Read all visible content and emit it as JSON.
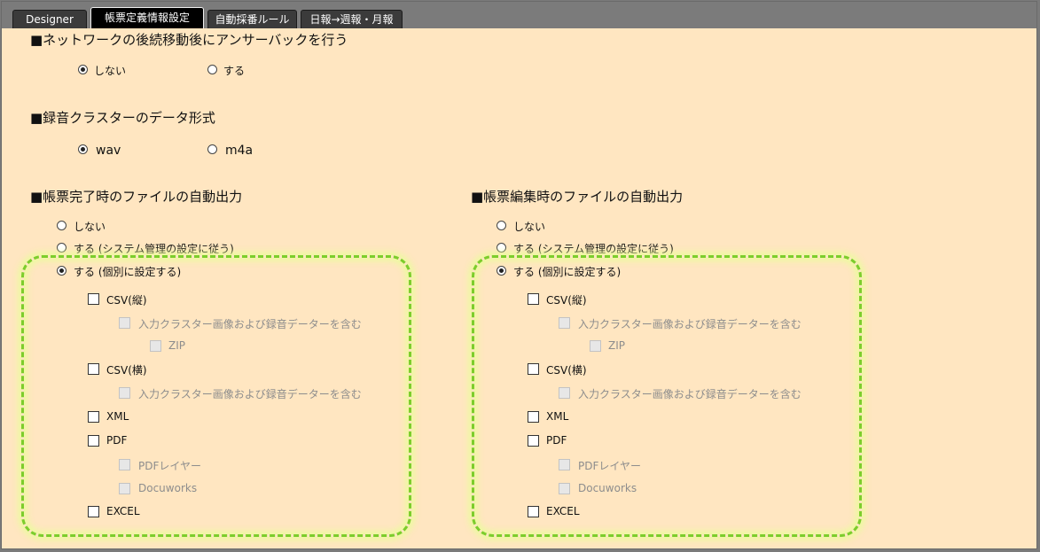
{
  "tabs": [
    {
      "label": "Designer"
    },
    {
      "label": "帳票定義情報設定"
    },
    {
      "label": "自動採番ルール"
    },
    {
      "label": "日報→週報・月報"
    }
  ],
  "answerback": {
    "heading": "■ネットワークの後続移動後にアンサーバックを行う",
    "options": [
      "しない",
      "する"
    ]
  },
  "audio_format": {
    "heading": "■録音クラスターのデータ形式",
    "options": [
      "wav",
      "m4a"
    ]
  },
  "auto_output_complete": {
    "heading": "■帳票完了時のファイルの自動出力",
    "options": [
      "しない",
      "する (システム管理の設定に従う)",
      "する (個別に設定する)"
    ],
    "csv_v": "CSV(縦)",
    "include_image_audio": "入力クラスター画像および録音データーを含む",
    "zip": "ZIP",
    "csv_h": "CSV(横)",
    "include_image_audio_h": "入力クラスター画像および録音データーを含む",
    "xml": "XML",
    "pdf": "PDF",
    "pdf_layer": "PDFレイヤー",
    "docuworks": "Docuworks",
    "excel": "EXCEL"
  },
  "auto_output_edit": {
    "heading": "■帳票編集時のファイルの自動出力",
    "options": [
      "しない",
      "する (システム管理の設定に従う)",
      "する (個別に設定する)"
    ],
    "csv_v": "CSV(縦)",
    "include_image_audio": "入力クラスター画像および録音データーを含む",
    "zip": "ZIP",
    "csv_h": "CSV(横)",
    "include_image_audio_h": "入力クラスター画像および録音データーを含む",
    "xml": "XML",
    "pdf": "PDF",
    "pdf_layer": "PDFレイヤー",
    "docuworks": "Docuworks",
    "excel": "EXCEL"
  },
  "colors": {
    "panel_bg": "#ffe6c1",
    "highlight": "#7ccd2c",
    "tab_active": "#000000",
    "tab_inactive": "#3b3b3b"
  }
}
